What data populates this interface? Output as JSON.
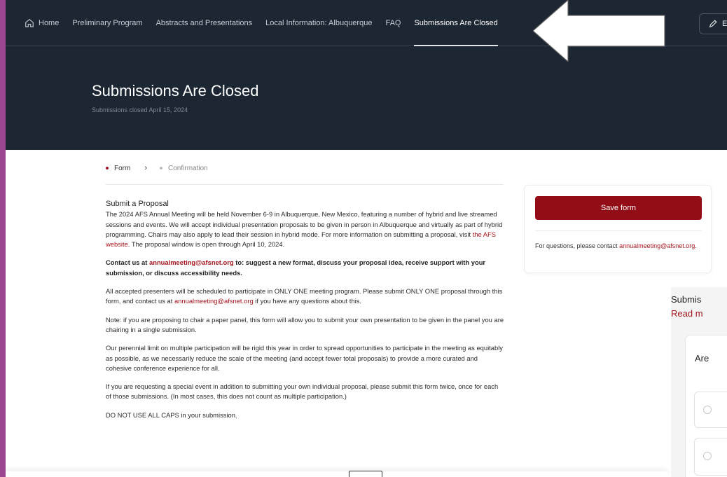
{
  "nav": {
    "items": [
      {
        "label": "Home"
      },
      {
        "label": "Preliminary Program"
      },
      {
        "label": "Abstracts and Presentations"
      },
      {
        "label": "Local Information: Albuquerque"
      },
      {
        "label": "FAQ"
      },
      {
        "label": "Submissions Are Closed"
      }
    ],
    "active_index": 5,
    "edit_label": "E"
  },
  "hero": {
    "title": "Submissions Are Closed",
    "subtitle": "Submissions closed April 15, 2024"
  },
  "steps": {
    "current": "Form",
    "next": "Confirmation"
  },
  "main": {
    "heading": "Submit a Proposal",
    "p1_before": "The 2024 AFS Annual Meeting will be held November 6-9 in Albuquerque, New Mexico, featuring a number of hybrid and live streamed sessions and events. We will accept individual presentation proposals to be given in person in Albuquerque and virtually as part of hybrid programming. Chairs may also apply to lead their session in hybrid mode. For more information on submitting a proposal, visit ",
    "p1_link": "the AFS website",
    "p1_after": ". The proposal window is open through April 10, 2024.",
    "p2_before": "Contact us at ",
    "p2_link": "annualmeeting@afsnet.org",
    "p2_after": " to: suggest a new format, discuss your proposal idea, receive support with your submission, or discuss accessibility needs.",
    "p3_before": "All accepted presenters will be scheduled to participate in ONLY ONE meeting program. Please submit ONLY ONE proposal through this form, and contact us at ",
    "p3_link": "annualmeeting@afsnet.org",
    "p3_after": " if you have any questions about this.",
    "p4": "Note: if you are proposing to chair a paper panel, this form will allow you to submit your own presentation to be given in the panel you are chairing in a single submission.",
    "p5": "Our perennial limit on multiple participation will be rigid this year in order to spread opportunities to participate in the meeting as equitably as possible, as we necessarily reduce the scale of the meeting (and accept fewer total proposals) to provide a more curated and cohesive conference experience for all.",
    "p6": "If you are requesting a special event in addition to submitting your own individual proposal, please submit this form twice, once for each of those submissions. (In most cases, this does not count as multiple participation.)",
    "p7": "DO NOT USE ALL CAPS in your submission."
  },
  "side_card": {
    "save_label": "Save form",
    "contact_text": "For questions, please contact ",
    "contact_link": "annualmeeting@afsnet.org",
    "contact_end": "."
  },
  "right_panel": {
    "title": "Submis",
    "link": "Read m",
    "question": "Are"
  },
  "colors": {
    "nav_bg": "#1d2733",
    "accent": "#930d16",
    "link": "#a5141d",
    "frame": "#9c4593"
  }
}
